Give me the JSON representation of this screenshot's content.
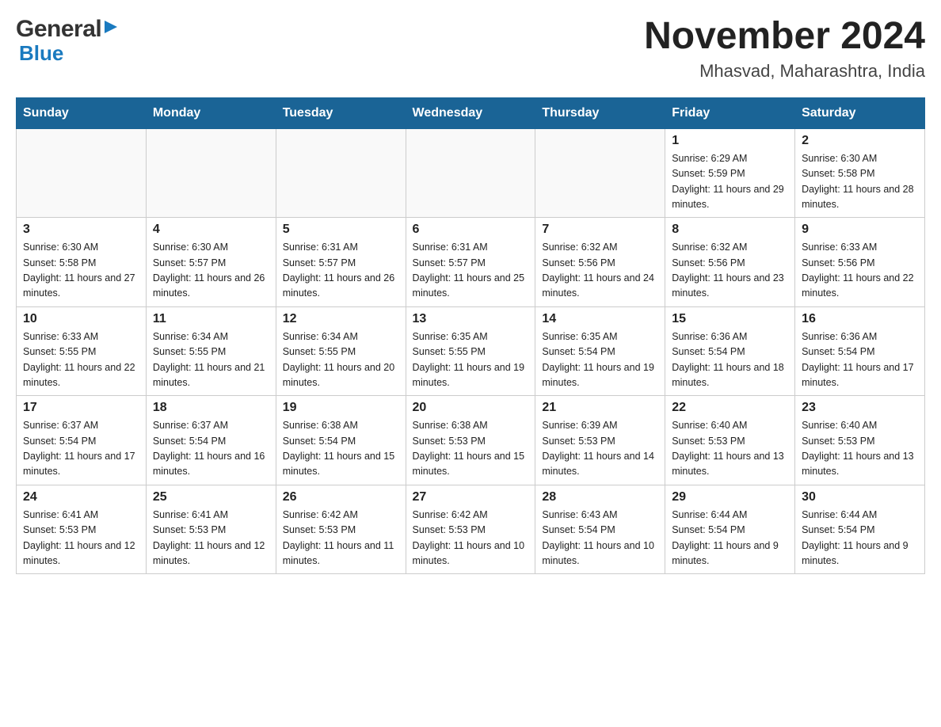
{
  "header": {
    "title": "November 2024",
    "subtitle": "Mhasvad, Maharashtra, India",
    "logo_general": "General",
    "logo_blue": "Blue"
  },
  "days_of_week": [
    "Sunday",
    "Monday",
    "Tuesday",
    "Wednesday",
    "Thursday",
    "Friday",
    "Saturday"
  ],
  "weeks": [
    [
      {
        "day": "",
        "info": ""
      },
      {
        "day": "",
        "info": ""
      },
      {
        "day": "",
        "info": ""
      },
      {
        "day": "",
        "info": ""
      },
      {
        "day": "",
        "info": ""
      },
      {
        "day": "1",
        "info": "Sunrise: 6:29 AM\nSunset: 5:59 PM\nDaylight: 11 hours and 29 minutes."
      },
      {
        "day": "2",
        "info": "Sunrise: 6:30 AM\nSunset: 5:58 PM\nDaylight: 11 hours and 28 minutes."
      }
    ],
    [
      {
        "day": "3",
        "info": "Sunrise: 6:30 AM\nSunset: 5:58 PM\nDaylight: 11 hours and 27 minutes."
      },
      {
        "day": "4",
        "info": "Sunrise: 6:30 AM\nSunset: 5:57 PM\nDaylight: 11 hours and 26 minutes."
      },
      {
        "day": "5",
        "info": "Sunrise: 6:31 AM\nSunset: 5:57 PM\nDaylight: 11 hours and 26 minutes."
      },
      {
        "day": "6",
        "info": "Sunrise: 6:31 AM\nSunset: 5:57 PM\nDaylight: 11 hours and 25 minutes."
      },
      {
        "day": "7",
        "info": "Sunrise: 6:32 AM\nSunset: 5:56 PM\nDaylight: 11 hours and 24 minutes."
      },
      {
        "day": "8",
        "info": "Sunrise: 6:32 AM\nSunset: 5:56 PM\nDaylight: 11 hours and 23 minutes."
      },
      {
        "day": "9",
        "info": "Sunrise: 6:33 AM\nSunset: 5:56 PM\nDaylight: 11 hours and 22 minutes."
      }
    ],
    [
      {
        "day": "10",
        "info": "Sunrise: 6:33 AM\nSunset: 5:55 PM\nDaylight: 11 hours and 22 minutes."
      },
      {
        "day": "11",
        "info": "Sunrise: 6:34 AM\nSunset: 5:55 PM\nDaylight: 11 hours and 21 minutes."
      },
      {
        "day": "12",
        "info": "Sunrise: 6:34 AM\nSunset: 5:55 PM\nDaylight: 11 hours and 20 minutes."
      },
      {
        "day": "13",
        "info": "Sunrise: 6:35 AM\nSunset: 5:55 PM\nDaylight: 11 hours and 19 minutes."
      },
      {
        "day": "14",
        "info": "Sunrise: 6:35 AM\nSunset: 5:54 PM\nDaylight: 11 hours and 19 minutes."
      },
      {
        "day": "15",
        "info": "Sunrise: 6:36 AM\nSunset: 5:54 PM\nDaylight: 11 hours and 18 minutes."
      },
      {
        "day": "16",
        "info": "Sunrise: 6:36 AM\nSunset: 5:54 PM\nDaylight: 11 hours and 17 minutes."
      }
    ],
    [
      {
        "day": "17",
        "info": "Sunrise: 6:37 AM\nSunset: 5:54 PM\nDaylight: 11 hours and 17 minutes."
      },
      {
        "day": "18",
        "info": "Sunrise: 6:37 AM\nSunset: 5:54 PM\nDaylight: 11 hours and 16 minutes."
      },
      {
        "day": "19",
        "info": "Sunrise: 6:38 AM\nSunset: 5:54 PM\nDaylight: 11 hours and 15 minutes."
      },
      {
        "day": "20",
        "info": "Sunrise: 6:38 AM\nSunset: 5:53 PM\nDaylight: 11 hours and 15 minutes."
      },
      {
        "day": "21",
        "info": "Sunrise: 6:39 AM\nSunset: 5:53 PM\nDaylight: 11 hours and 14 minutes."
      },
      {
        "day": "22",
        "info": "Sunrise: 6:40 AM\nSunset: 5:53 PM\nDaylight: 11 hours and 13 minutes."
      },
      {
        "day": "23",
        "info": "Sunrise: 6:40 AM\nSunset: 5:53 PM\nDaylight: 11 hours and 13 minutes."
      }
    ],
    [
      {
        "day": "24",
        "info": "Sunrise: 6:41 AM\nSunset: 5:53 PM\nDaylight: 11 hours and 12 minutes."
      },
      {
        "day": "25",
        "info": "Sunrise: 6:41 AM\nSunset: 5:53 PM\nDaylight: 11 hours and 12 minutes."
      },
      {
        "day": "26",
        "info": "Sunrise: 6:42 AM\nSunset: 5:53 PM\nDaylight: 11 hours and 11 minutes."
      },
      {
        "day": "27",
        "info": "Sunrise: 6:42 AM\nSunset: 5:53 PM\nDaylight: 11 hours and 10 minutes."
      },
      {
        "day": "28",
        "info": "Sunrise: 6:43 AM\nSunset: 5:54 PM\nDaylight: 11 hours and 10 minutes."
      },
      {
        "day": "29",
        "info": "Sunrise: 6:44 AM\nSunset: 5:54 PM\nDaylight: 11 hours and 9 minutes."
      },
      {
        "day": "30",
        "info": "Sunrise: 6:44 AM\nSunset: 5:54 PM\nDaylight: 11 hours and 9 minutes."
      }
    ]
  ]
}
